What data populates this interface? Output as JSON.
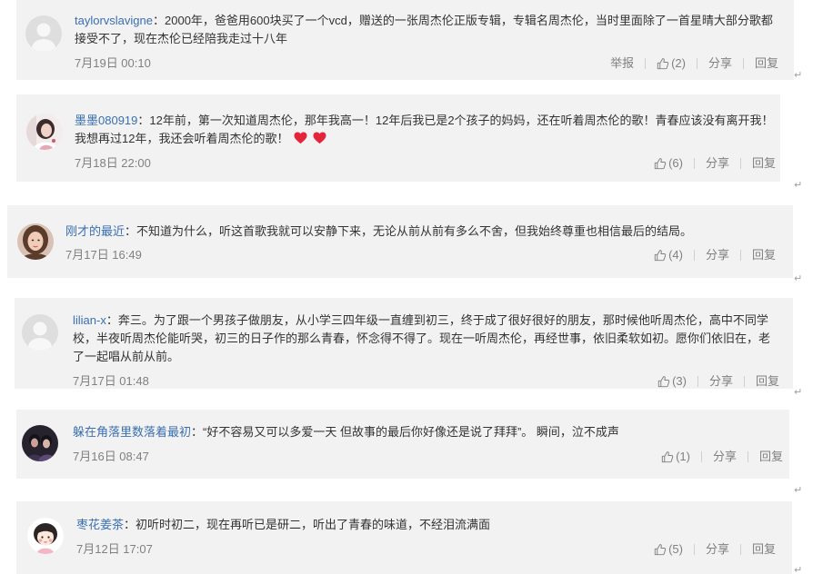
{
  "colors": {
    "card_background": "#f2f2f2",
    "username": "#3a6fb0",
    "text": "#333333",
    "meta": "#808080",
    "divider": "#d0d0d0",
    "heart": "#e5243b"
  },
  "icons": {
    "like": "thumbs-up-icon",
    "emoticon": "heart-icon"
  },
  "name_separator": "：",
  "paragraph_mark": "↵",
  "actions": {
    "share": "分享",
    "reply": "回复"
  },
  "comments": [
    {
      "avatar": "default-avatar-icon",
      "username": "taylorvslavigne",
      "text": "2000年，爸爸用600块买了一个vcd，赠送的一张周杰伦正版专辑，专辑名周杰伦，当时里面除了一首星晴大部分歌都接受不了，现在杰伦已经陪我走过十八年",
      "time": "7月19日 00:10",
      "report_label": "举报",
      "like_count": "(2)"
    },
    {
      "avatar": "user-photo-avatar",
      "username": "墨墨080919",
      "text": "12年前，第一次知道周杰伦，那年我高一！12年后我已是2个孩子的妈妈，还在听着周杰伦的歌！青春应该没有离开我！我想再过12年，我还会听着周杰伦的歌！",
      "emoticons": [
        "heart-icon",
        "heart-icon"
      ],
      "time": "7月18日 22:00",
      "like_count": "(6)"
    },
    {
      "avatar": "user-photo-avatar",
      "username": "刚才的最近",
      "text": "不知道为什么，听这首歌我就可以安静下来，无论从前从前有多么不舍，但我始终尊重也相信最后的结局。",
      "time": "7月17日 16:49",
      "like_count": "(4)"
    },
    {
      "avatar": "default-avatar-icon",
      "username": "lilian-x",
      "text": "奔三。为了跟一个男孩子做朋友，从小学三四年级一直缠到初三，终于成了很好很好的朋友，那时候他听周杰伦，高中不同学校，半夜听周杰伦能听哭，初三的日子作的那么青春，怀念得不得了。现在一听周杰伦，再经世事，依旧柔软如初。愿你们依旧在，老了一起唱从前从前。",
      "time": "7月17日 01:48",
      "like_count": "(3)"
    },
    {
      "avatar": "user-photo-avatar",
      "username": "躲在角落里数落着最初",
      "text": "“好不容易又可以多爱一天 但故事的最后你好像还是说了拜拜”。 瞬间，泣不成声",
      "time": "7月16日 08:47",
      "like_count": "(1)"
    },
    {
      "avatar": "cartoon-avatar",
      "username": "枣花姜茶",
      "text": "初听时初二，现在再听已是研二，听出了青春的味道，不经泪流满面",
      "time": "7月12日 17:07",
      "like_count": "(5)"
    }
  ]
}
